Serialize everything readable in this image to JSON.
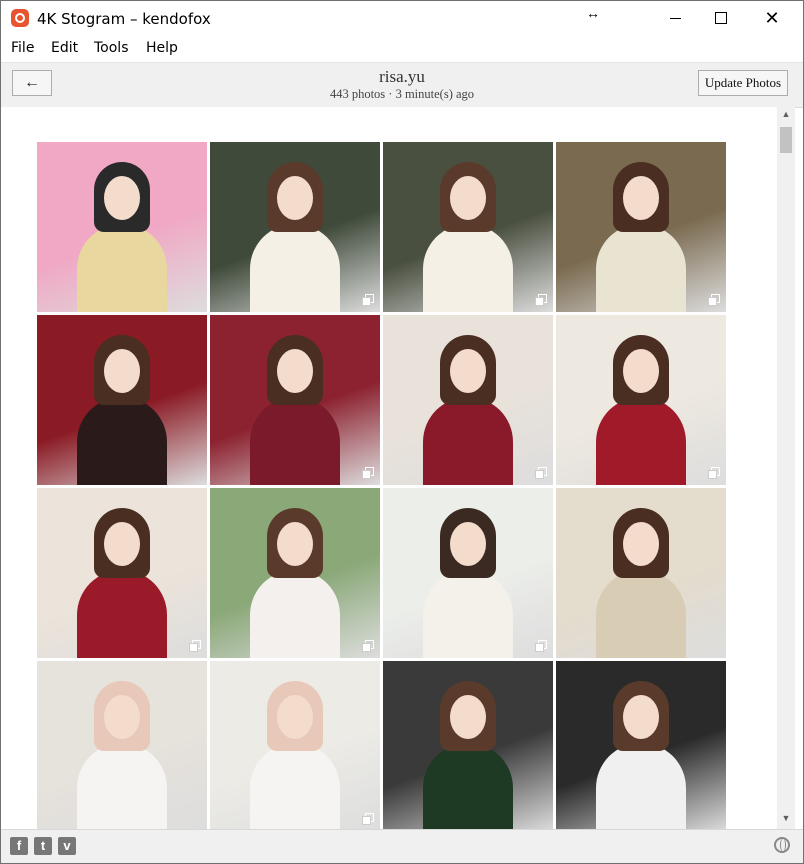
{
  "window": {
    "title": "4K Stogram – kendofox"
  },
  "menu": [
    "File",
    "Edit",
    "Tools",
    "Help"
  ],
  "header": {
    "back_label": "←",
    "profile_name": "risa.yu",
    "profile_meta": "443 photos · 3 minute(s) ago",
    "update_label": "Update Photos"
  },
  "grid": {
    "thumbnails": [
      {
        "bg": "#f0a8c4",
        "body": "#e8d8a0",
        "multi": false,
        "hair": "#2a2a2a"
      },
      {
        "bg": "#3f4a3a",
        "body": "#f4f0e6",
        "multi": true,
        "hair": "#5a3a2a"
      },
      {
        "bg": "#4a5040",
        "body": "#f4f0e6",
        "multi": true,
        "hair": "#5a3a2a"
      },
      {
        "bg": "#7a6a50",
        "body": "#e9e4d2",
        "multi": true,
        "hair": "#4a2e22"
      },
      {
        "bg": "#8a1a24",
        "body": "#2a1a1a",
        "multi": false,
        "hair": "#4a2e22"
      },
      {
        "bg": "#8c2230",
        "body": "#7a1a2a",
        "multi": true,
        "hair": "#4a2e22"
      },
      {
        "bg": "#e8e2da",
        "body": "#8a1a2a",
        "multi": true,
        "hair": "#4a2e22"
      },
      {
        "bg": "#ede8e0",
        "body": "#a01a2a",
        "multi": true,
        "hair": "#4a2e22"
      },
      {
        "bg": "#ece4da",
        "body": "#9a1a2a",
        "multi": true,
        "hair": "#4a2e22"
      },
      {
        "bg": "#8aa878",
        "body": "#f4f0ee",
        "multi": true,
        "hair": "#5a3a2a"
      },
      {
        "bg": "#eceeea",
        "body": "#f4f0ea",
        "multi": true,
        "hair": "#3a2a22"
      },
      {
        "bg": "#e4dccc",
        "body": "#d8ccb4",
        "multi": false,
        "hair": "#4a2e22"
      },
      {
        "bg": "#e6e2dc",
        "body": "#f6f4f2",
        "multi": false,
        "hair": "#e8c8b8"
      },
      {
        "bg": "#ecebe6",
        "body": "#f6f4f2",
        "multi": true,
        "hair": "#e8c8b8"
      },
      {
        "bg": "#3a3a3a",
        "body": "#1e3a24",
        "multi": false,
        "hair": "#5a3a2a"
      },
      {
        "bg": "#2a2a2a",
        "body": "#f0f0f0",
        "multi": false,
        "hair": "#5a3a2a"
      }
    ]
  },
  "footer": {
    "facebook": "f",
    "twitter": "t",
    "vimeo": "v"
  }
}
